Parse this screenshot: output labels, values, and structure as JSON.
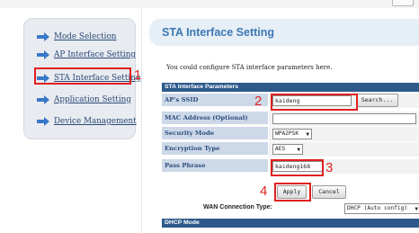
{
  "sidebar": {
    "items": [
      {
        "label": "Mode Selection",
        "icon": "arrow-right-icon"
      },
      {
        "label": "AP Interface Setting",
        "icon": "arrow-right-icon"
      },
      {
        "label": "STA Interface Setting",
        "icon": "arrow-right-icon"
      },
      {
        "label": "Application Setting",
        "icon": "arrow-right-icon"
      },
      {
        "label": "Device Management",
        "icon": "arrow-right-icon"
      }
    ]
  },
  "page": {
    "title": "STA Interface Setting",
    "intro": "You could configure STA interface parameters here."
  },
  "sta_params": {
    "header": "STA Interface Parameters",
    "ssid_label": "AP's SSID",
    "ssid_value": "kaideng",
    "search_label": "Search...",
    "mac_label": "MAC Address (Optional)",
    "mac_value": "",
    "security_label": "Security Mode",
    "security_value": "WPA2PSK",
    "encryption_label": "Encryption Type",
    "encryption_value": "AES",
    "pass_label": "Pass Phrase",
    "pass_value": "kaideng168"
  },
  "buttons": {
    "apply": "Apply",
    "cancel": "Cancel"
  },
  "wan": {
    "label": "WAN Connection Type:",
    "value": "DHCP (Auto config)"
  },
  "dhcp": {
    "header": "DHCP Mode"
  },
  "annotations": {
    "n1": "1",
    "n2": "2",
    "n3": "3",
    "n4": "4"
  },
  "colors": {
    "annotation": "#e02020",
    "section_header": "#2d5a8a",
    "title": "#3c78b4",
    "label_bg": "#cdd8e8"
  }
}
